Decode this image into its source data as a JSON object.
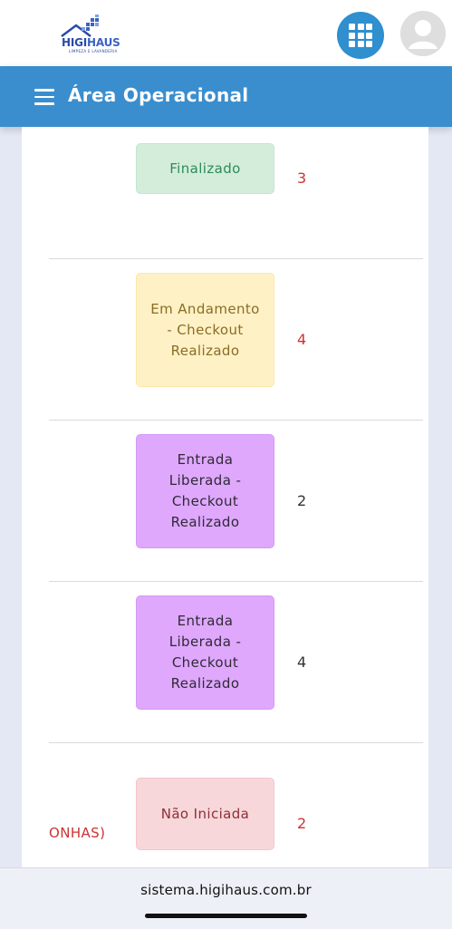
{
  "header": {
    "logo": {
      "brand_a": "HIGI",
      "brand_b": "HAUS",
      "tagline": "LIMPEZA E LAVANDERIA"
    },
    "apps_icon": "apps-grid-icon",
    "avatar_icon": "user-avatar-icon"
  },
  "navbar": {
    "menu_icon": "hamburger-icon",
    "title": "Área Operacional",
    "color": "#3a8ece"
  },
  "rows": [
    {
      "status": "Finalizado",
      "count": "3",
      "status_color": "green"
    },
    {
      "status": "Em Andamento - Checkout Realizado",
      "count": "4",
      "status_color": "yellow"
    },
    {
      "status": "Entrada Liberada - Checkout Realizado",
      "count": "2",
      "status_color": "purple"
    },
    {
      "status": "Entrada Liberada - Checkout Realizado",
      "count": "4",
      "status_color": "purple"
    },
    {
      "status": "Não Iniciada",
      "count": "2",
      "status_color": "pink",
      "clipped_text": "ONHAS)"
    }
  ],
  "browser": {
    "url": "sistema.higihaus.com.br"
  }
}
